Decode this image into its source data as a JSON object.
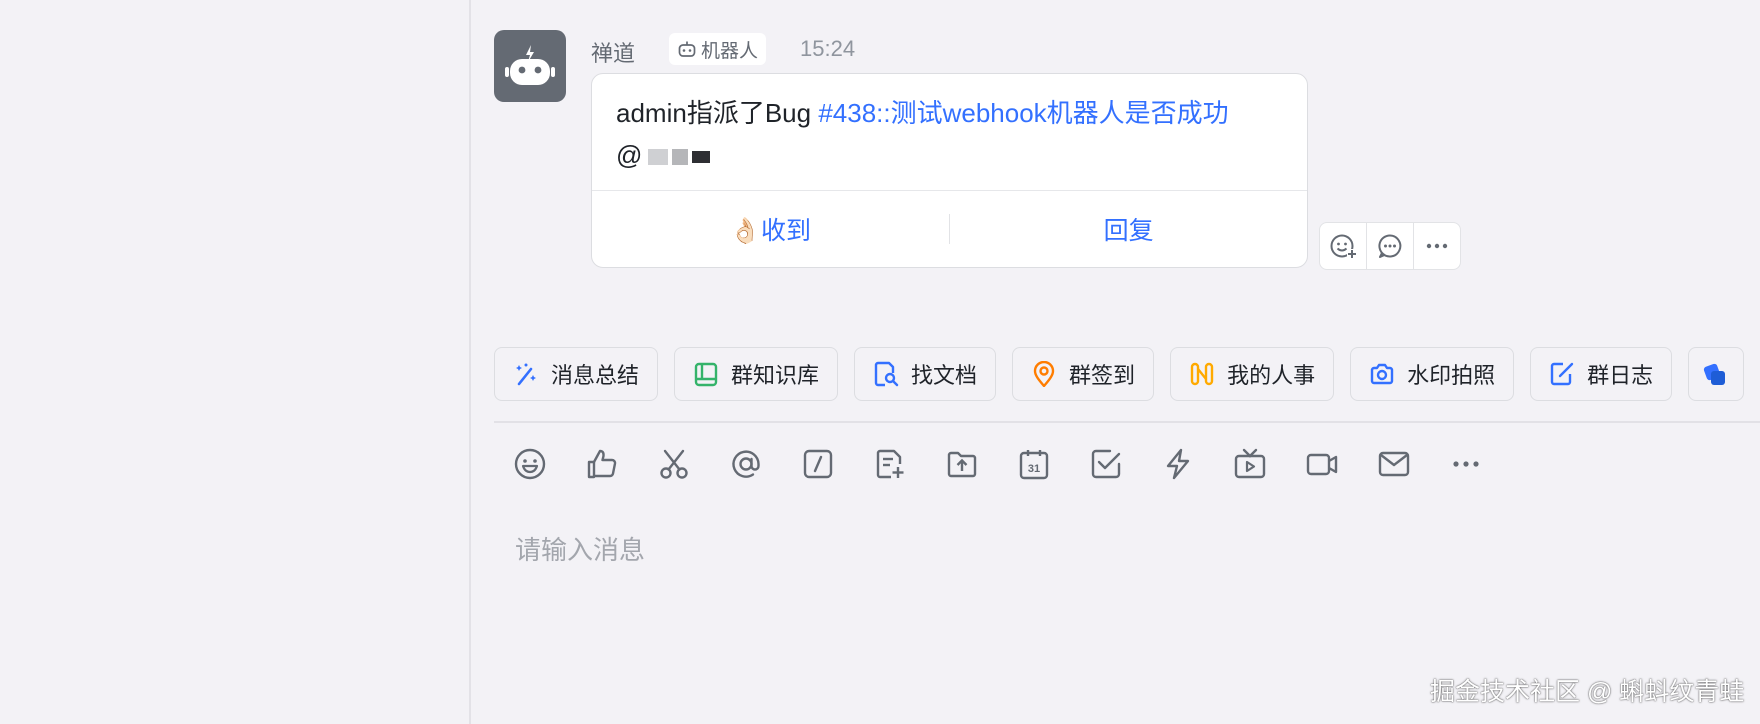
{
  "message": {
    "sender": "禅道",
    "bot_tag": "机器人",
    "time": "15:24",
    "text_prefix": "admin指派了Bug ",
    "link_text": "#438::测试webhook机器人是否成功",
    "mention": "@",
    "actions": [
      {
        "emoji": "👌🏻",
        "label": "收到"
      },
      {
        "label": "回复"
      }
    ],
    "tool_icons": [
      "add-reaction-icon",
      "comment-icon",
      "more-icon"
    ]
  },
  "quick_apps": [
    {
      "label": "消息总结",
      "icon": "magic-wand-icon",
      "color": "#3370ff"
    },
    {
      "label": "群知识库",
      "icon": "book-icon",
      "color": "#34b36a"
    },
    {
      "label": "找文档",
      "icon": "doc-search-icon",
      "color": "#3370ff"
    },
    {
      "label": "群签到",
      "icon": "location-pin-icon",
      "color": "#ff7d00"
    },
    {
      "label": "我的人事",
      "icon": "hr-icon",
      "color": "#ffaa00"
    },
    {
      "label": "水印拍照",
      "icon": "camera-icon",
      "color": "#3370ff"
    },
    {
      "label": "群日志",
      "icon": "log-icon",
      "color": "#3370ff"
    }
  ],
  "toolbar_icons": [
    "emoji-icon",
    "thumbs-up-icon",
    "screenshot-scissors-icon",
    "mention-at-icon",
    "slash-command-icon",
    "new-doc-icon",
    "upload-file-icon",
    "calendar-icon",
    "task-check-icon",
    "quick-action-lightning-icon",
    "live-tv-icon",
    "video-call-icon",
    "mail-icon",
    "more-icon"
  ],
  "calendar_day": "31",
  "input": {
    "placeholder": "请输入消息"
  },
  "watermark": "掘金技术社区 @ 蝌蚪纹青蛙"
}
